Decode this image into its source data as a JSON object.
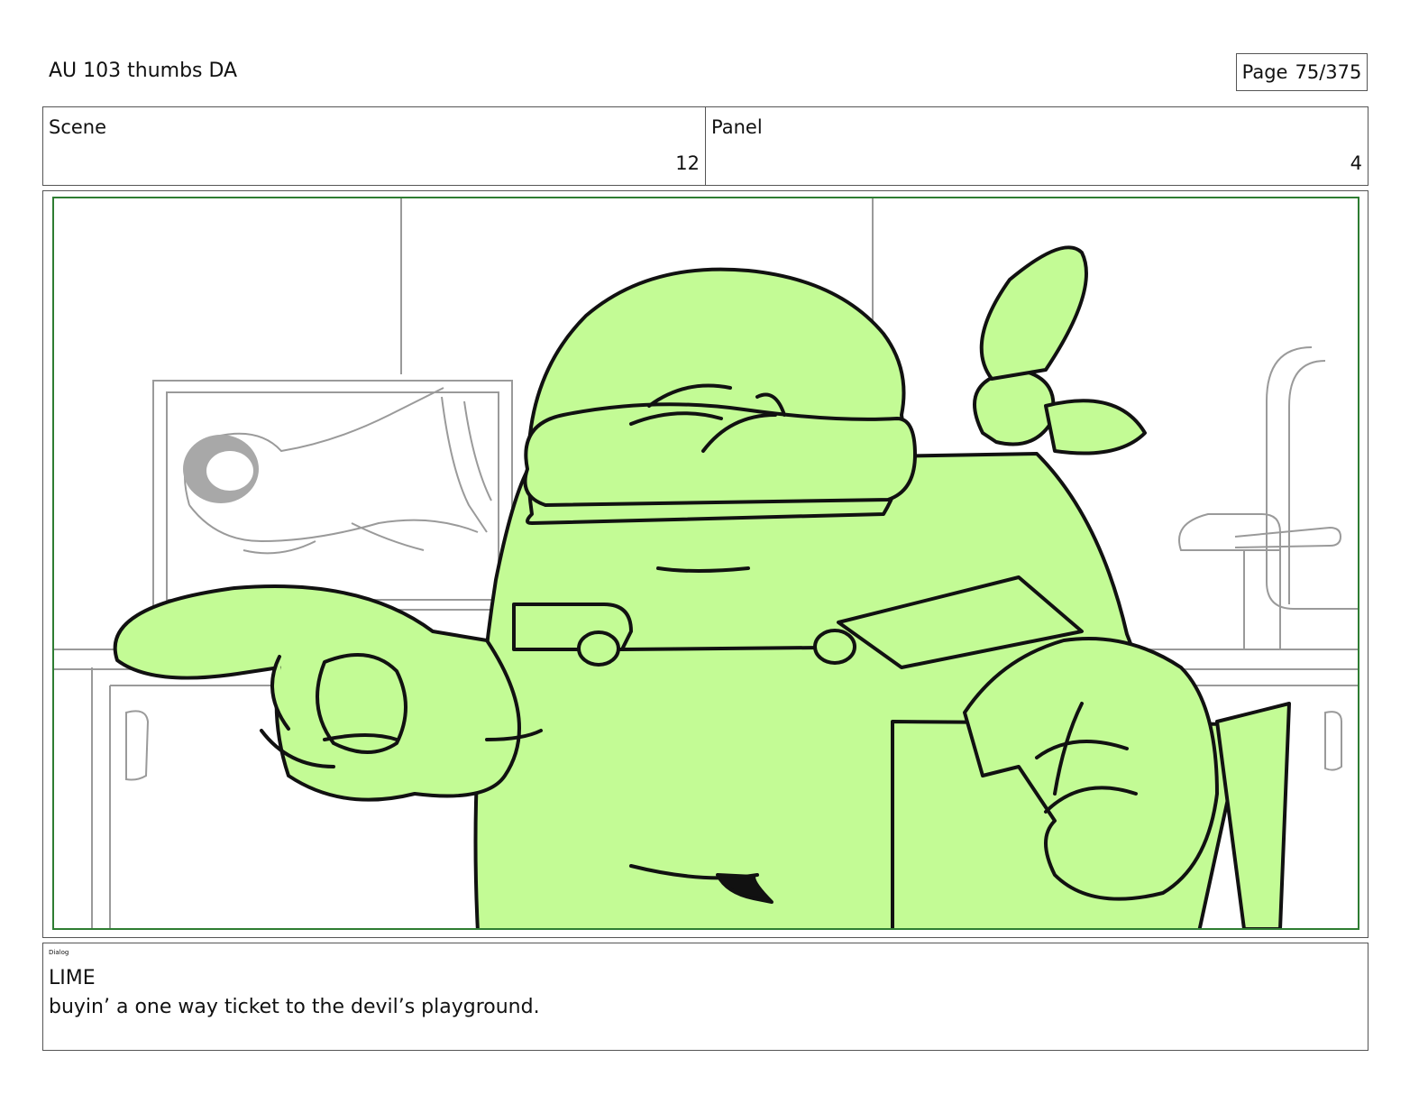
{
  "header": {
    "title": "AU 103 thumbs DA",
    "page_label": "Page",
    "page_value": "75/375"
  },
  "info": {
    "scene_label": "Scene",
    "scene_value": "12",
    "panel_label": "Panel",
    "panel_value": "4"
  },
  "colors": {
    "border": "#555555",
    "safe_frame": "#2e7d32",
    "character_fill": "#c3fb95",
    "ink": "#111111",
    "background_sketch": "#9a9a9a"
  },
  "artwork": {
    "subject": "sketch-panel"
  },
  "dialog": {
    "label": "Dialog",
    "character": "LIME",
    "line": "buyin’ a one way ticket to the devil’s playground."
  }
}
